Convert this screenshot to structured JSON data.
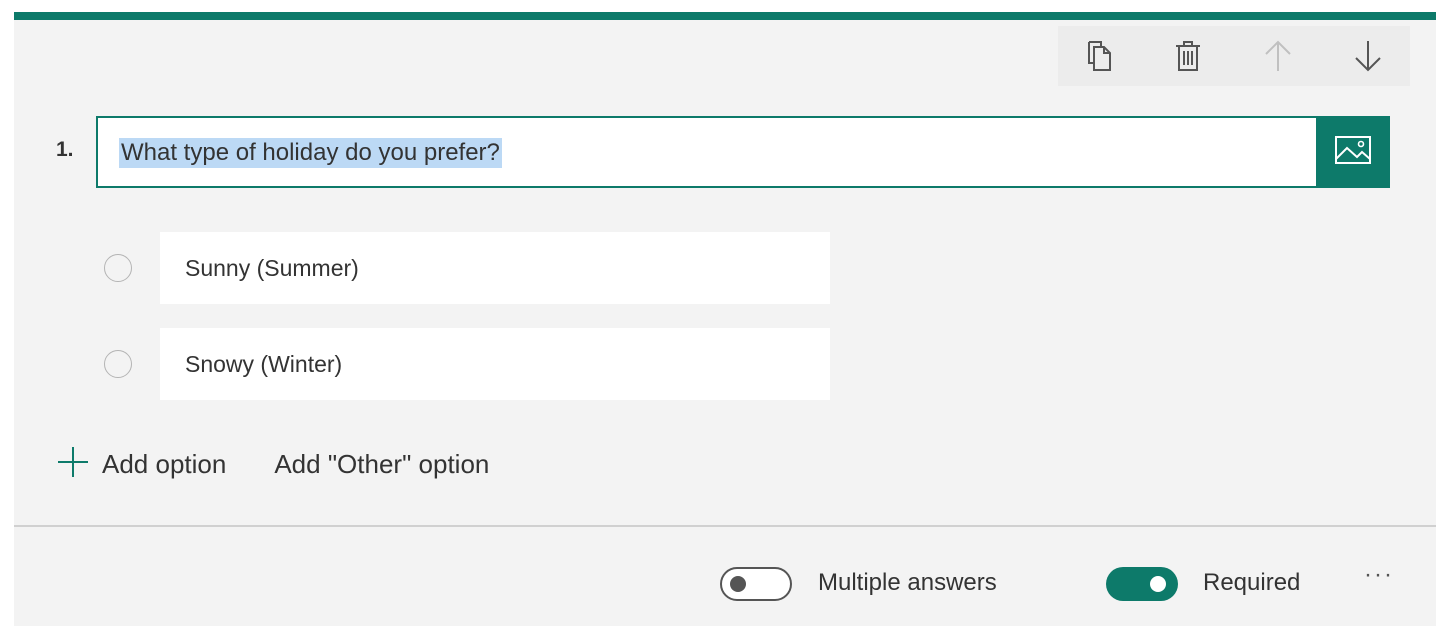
{
  "colors": {
    "accent": "#0d7a6a",
    "card_bg": "#f3f3f3",
    "selection": "#bcd9f5",
    "text": "#333333"
  },
  "toolbar": {
    "copy_icon": "copy-icon",
    "delete_icon": "trash-icon",
    "move_up_icon": "arrow-up-icon",
    "move_down_icon": "arrow-down-icon"
  },
  "question": {
    "number": "1.",
    "text": "What type of holiday do you prefer?",
    "image_icon": "image-icon"
  },
  "options": [
    {
      "label": "Sunny (Summer)"
    },
    {
      "label": "Snowy (Winter)"
    }
  ],
  "add": {
    "add_option_label": "Add option",
    "add_other_label": "Add \"Other\" option"
  },
  "footer": {
    "multiple_answers_label": "Multiple answers",
    "multiple_answers_on": false,
    "required_label": "Required",
    "required_on": true,
    "more_label": "···"
  }
}
